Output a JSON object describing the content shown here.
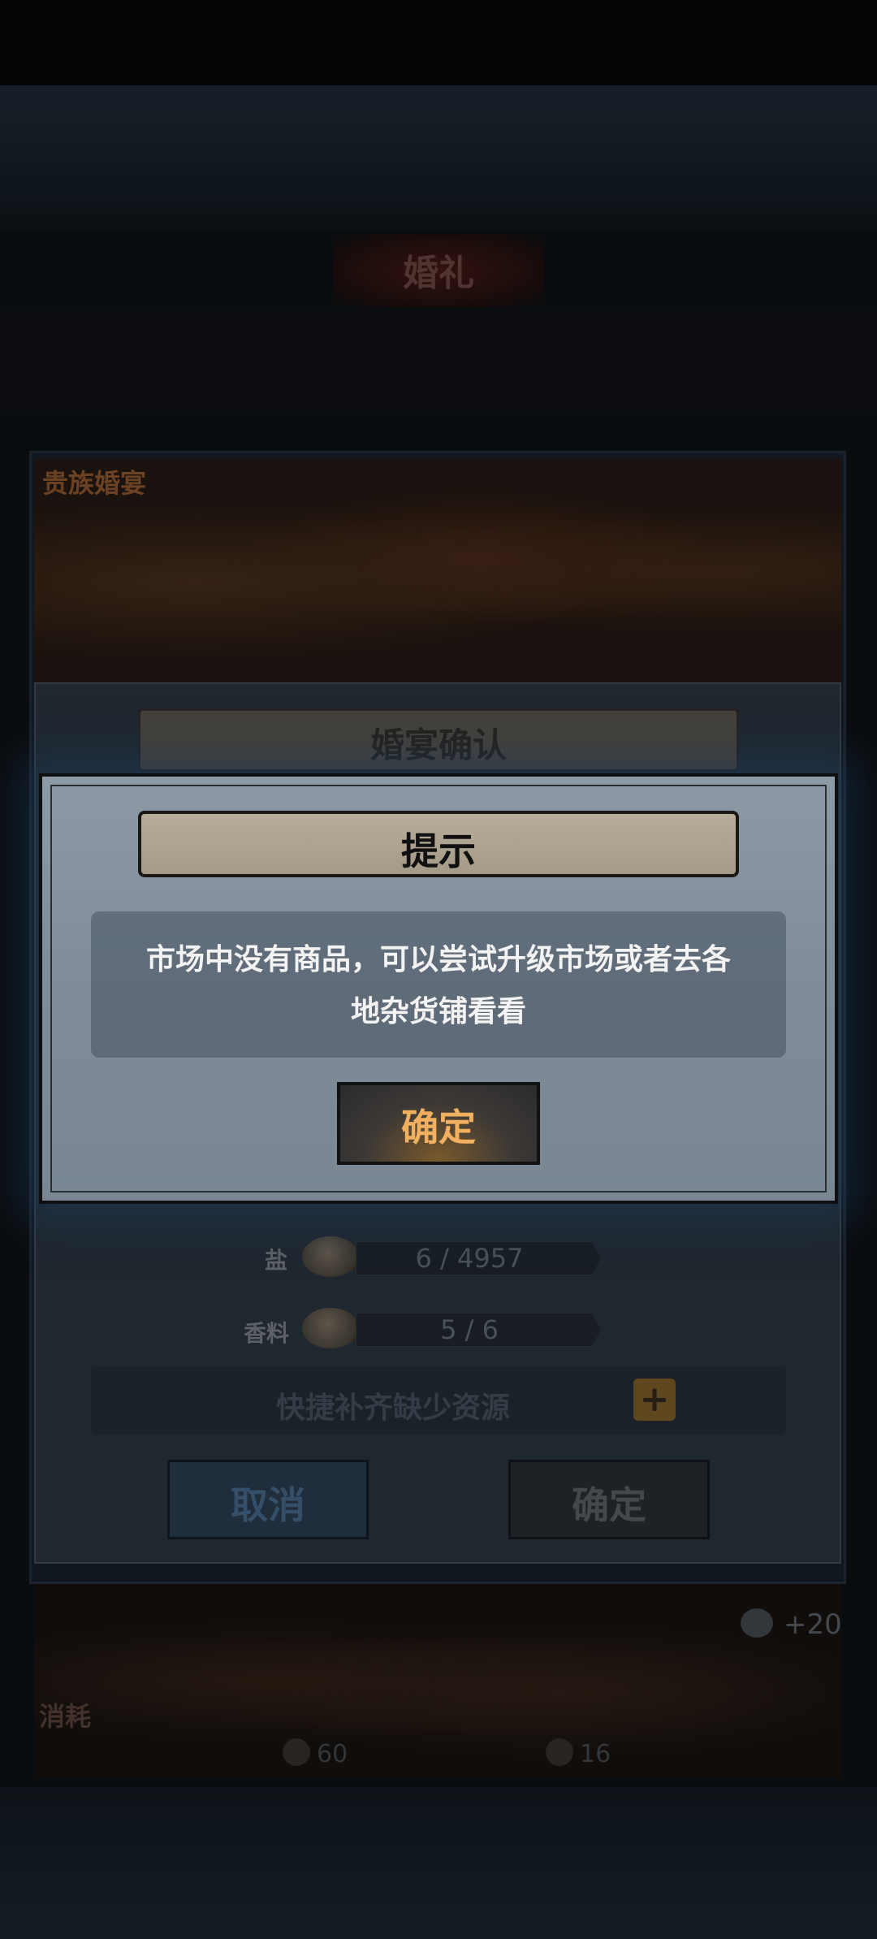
{
  "page": {
    "title": "婚礼"
  },
  "banner": {
    "label": "贵族婚宴"
  },
  "confirm_panel": {
    "header": "婚宴确认",
    "resources": [
      {
        "label": "盐",
        "icon": "salt-sack-icon",
        "value": "6 / 4957"
      },
      {
        "label": "香料",
        "icon": "spice-bag-icon",
        "value": "5 / 6"
      }
    ],
    "quick_fill_label": "快捷补齐缺少资源",
    "plus_symbol": "+",
    "cancel_label": "取消",
    "ok_label": "确定"
  },
  "bottom_scene": {
    "reward": "+20",
    "consume_label": "消耗",
    "costs": [
      "60",
      "16"
    ]
  },
  "dialog": {
    "title": "提示",
    "message_line1": "市场中没有商品，可以尝试升级市场或者去各",
    "message_line2": "地杂货铺看看",
    "ok_label": "确定"
  },
  "colors": {
    "dialog_bg": "#8d9aa6",
    "title_scroll": "#b8ad9b",
    "ok_text": "#f0b060",
    "overlay_glow": "#1e3c5f"
  }
}
